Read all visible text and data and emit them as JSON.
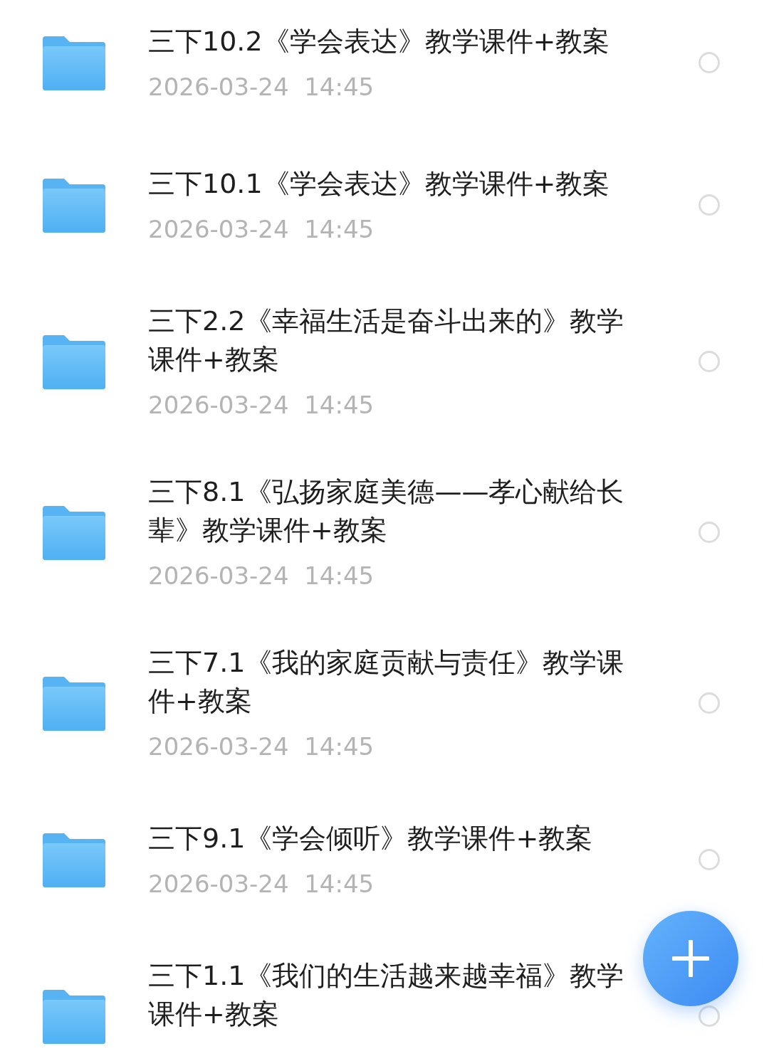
{
  "files": [
    {
      "title": "三下10.2《学会表达》教学课件+教案",
      "date": "2026-03-24  14:45",
      "selected": false
    },
    {
      "title": "三下10.1《学会表达》教学课件+教案",
      "date": "2026-03-24  14:45",
      "selected": false
    },
    {
      "title": "三下2.2《幸福生活是奋斗出来的》教学课件+教案",
      "date": "2026-03-24  14:45",
      "selected": false
    },
    {
      "title": "三下8.1《弘扬家庭美德——孝心献给长辈》教学课件+教案",
      "date": "2026-03-24  14:45",
      "selected": false
    },
    {
      "title": "三下7.1《我的家庭贡献与责任》教学课件+教案",
      "date": "2026-03-24  14:45",
      "selected": false
    },
    {
      "title": "三下9.1《学会倾听》教学课件+教案",
      "date": "2026-03-24  14:45",
      "selected": false
    },
    {
      "title": "三下1.1《我们的生活越来越幸福》教学课件+教案",
      "selected": false
    }
  ]
}
